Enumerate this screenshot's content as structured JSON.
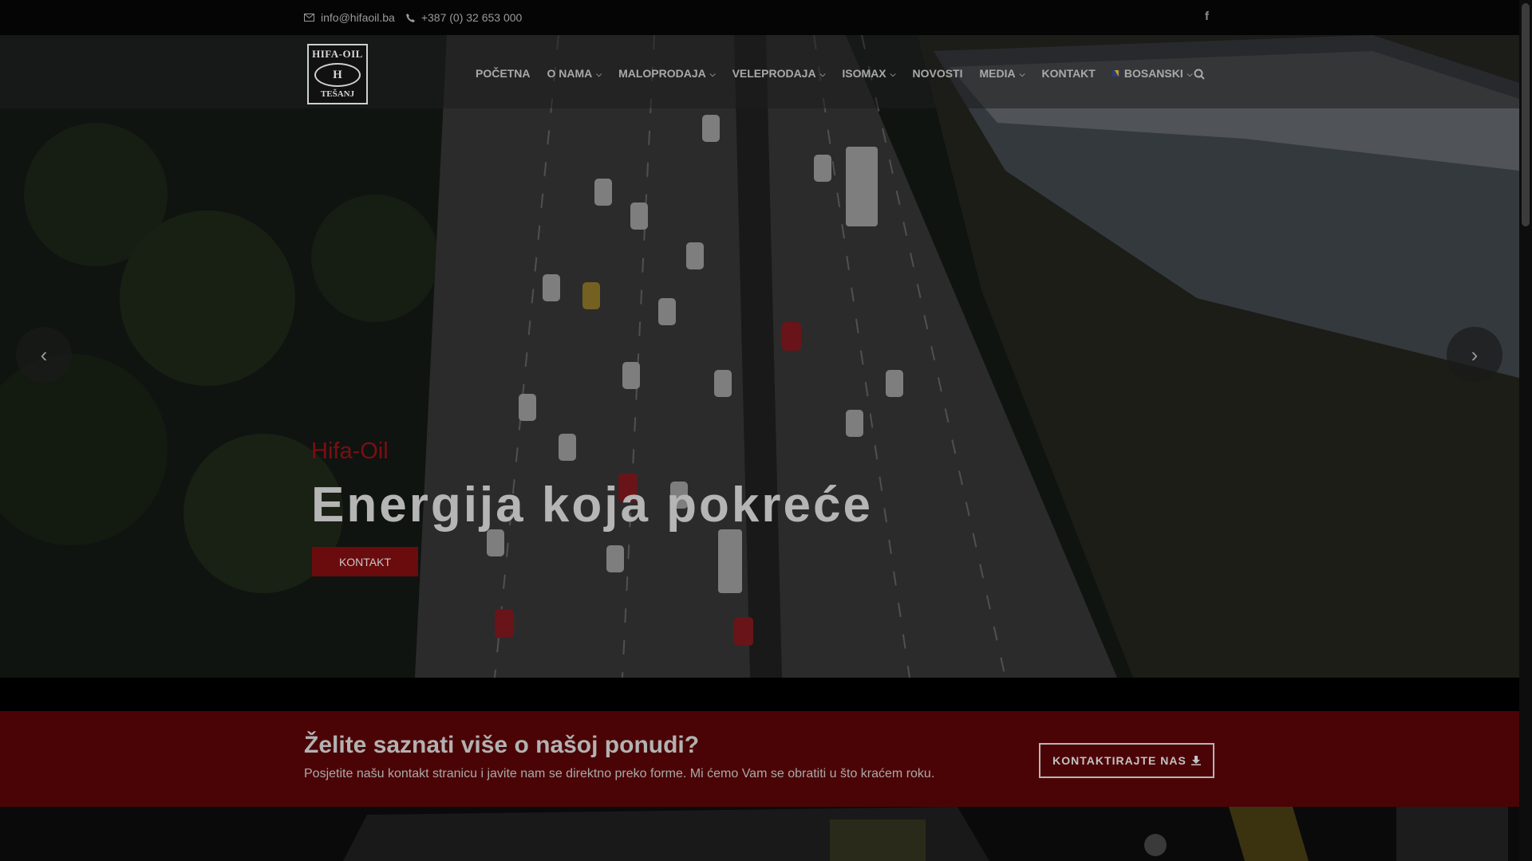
{
  "topbar": {
    "email": "info@hifaoil.ba",
    "phone": "+387 (0) 32 653 000",
    "social": "f"
  },
  "logo": {
    "line1": "HIFA-OIL",
    "mark": "H",
    "line2": "TEŠANJ"
  },
  "nav": {
    "items": [
      {
        "label": "POČETNA",
        "dropdown": false
      },
      {
        "label": "O NAMA",
        "dropdown": true
      },
      {
        "label": "MALOPRODAJA",
        "dropdown": true
      },
      {
        "label": "VELEPRODAJA",
        "dropdown": true
      },
      {
        "label": "ISOMAX",
        "dropdown": true
      },
      {
        "label": "NOVOSTI",
        "dropdown": false
      },
      {
        "label": "MEDIA",
        "dropdown": true
      },
      {
        "label": "KONTAKT",
        "dropdown": false
      }
    ],
    "language": "BOSANSKI"
  },
  "hero": {
    "subtitle": "Hifa-Oil",
    "headline": "Energija koja pokreće",
    "button": "KONTAKT",
    "prev_icon": "‹",
    "next_icon": "›"
  },
  "cta": {
    "title": "Želite saznati više o našoj ponudi?",
    "text": "Posjetite našu kontakt stranicu i javite nam se direktno preko forme. Mi ćemo Vam se obratiti u što kraćem roku.",
    "button": "KONTAKTIRAJTE NAS"
  },
  "colors": {
    "brand_red": "#6a0b0e",
    "cta_band": "#4b0406"
  }
}
